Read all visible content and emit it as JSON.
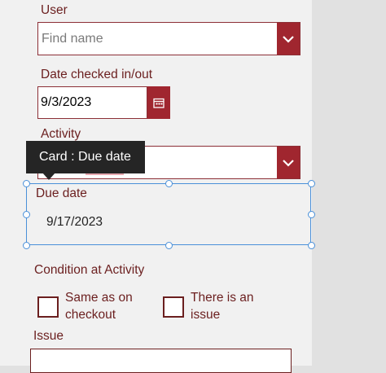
{
  "user": {
    "label": "User",
    "placeholder": "Find name"
  },
  "date_checked": {
    "label": "Date checked in/out",
    "value": "9/3/2023"
  },
  "activity": {
    "label": "Activity"
  },
  "tooltip": {
    "text": "Card : Due date"
  },
  "due_date": {
    "label": "Due date",
    "value": "9/17/2023"
  },
  "condition": {
    "label": "Condition at Activity",
    "option1_line1": "Same as on",
    "option1_line2": "checkout",
    "option2_line1": "There is an",
    "option2_line2": "issue"
  },
  "issue": {
    "label": "Issue"
  },
  "colors": {
    "accent": "#a0262f",
    "label_text": "#6b1f1f",
    "selection": "#4a90d9",
    "tooltip_bg": "#252525"
  },
  "icons": [
    "chevron-down-icon",
    "calendar-icon"
  ]
}
